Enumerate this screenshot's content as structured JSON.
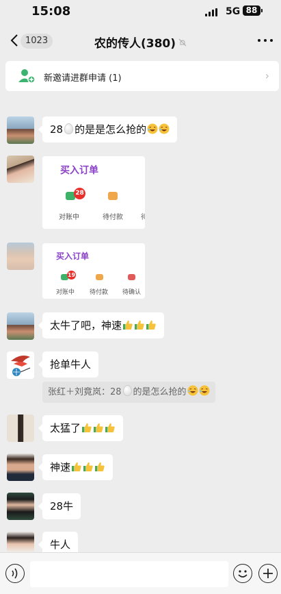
{
  "status_bar": {
    "time": "15:08",
    "network": "5G",
    "battery": "88"
  },
  "nav": {
    "back_count": "1023",
    "title": "农的传人(380)"
  },
  "invite": {
    "text": "新邀请进群申请 (1)"
  },
  "messages": [
    {
      "text": "28",
      "text_after": "的是是怎么抢的"
    },
    {
      "order_title": "买入订单",
      "labels": [
        "对账中",
        "待付款",
        "待"
      ],
      "badge": "28"
    },
    {
      "order_title": "买入订单",
      "labels": [
        "对账中",
        "待付款",
        "待确认"
      ],
      "badge": "19"
    },
    {
      "text": "太牛了吧，神速"
    },
    {
      "text": "抢单牛人"
    },
    {
      "quote_prefix": "张红＋刘竟岚：28",
      "quote_after": "的是怎么抢的"
    },
    {
      "text": "太猛了"
    },
    {
      "text": "神速"
    },
    {
      "text": "28牛"
    },
    {
      "text": "牛人"
    }
  ],
  "colors": {
    "accent_purple": "#8a42c8",
    "badge_red": "#e8302c",
    "wechat_green": "#07c160"
  }
}
